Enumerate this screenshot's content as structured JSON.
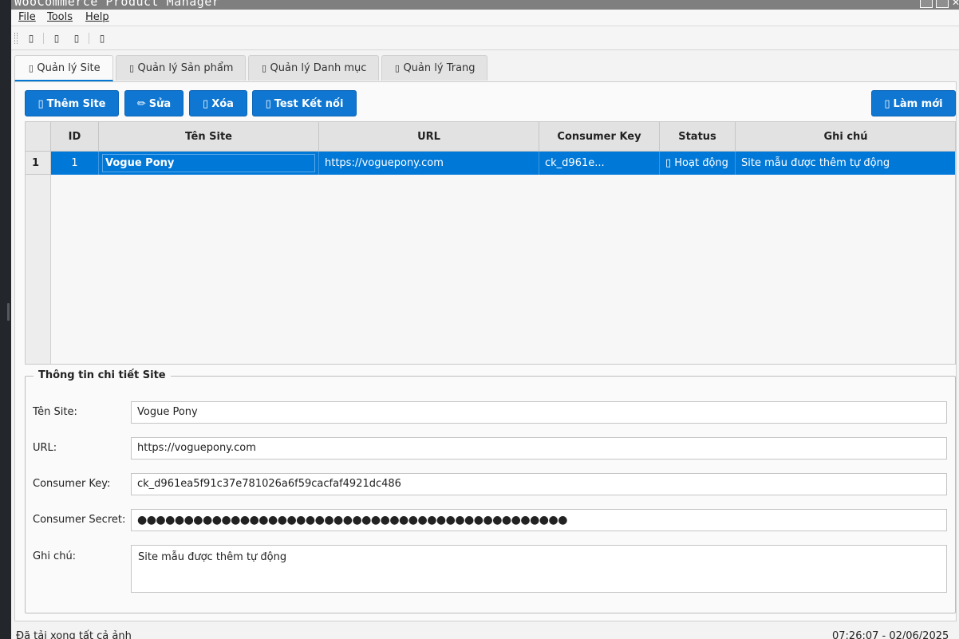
{
  "window": {
    "title": "WooCommerce Product Manager"
  },
  "menu": {
    "file": "File",
    "tools": "Tools",
    "help": "Help"
  },
  "toolbar": {
    "icons": [
      "new-icon",
      "open-icon",
      "save-icon",
      "settings-icon"
    ],
    "glyph": "▯"
  },
  "tabs": [
    {
      "label": "Quản lý Site",
      "icon": "▯"
    },
    {
      "label": "Quản lý Sản phẩm",
      "icon": "▯"
    },
    {
      "label": "Quản lý Danh mục",
      "icon": "▯"
    },
    {
      "label": "Quản lý Trang",
      "icon": "▯"
    }
  ],
  "actions": {
    "add": {
      "icon": "▯",
      "label": "Thêm Site"
    },
    "edit": {
      "icon": "✏",
      "label": "Sửa"
    },
    "delete": {
      "icon": "▯",
      "label": "Xóa"
    },
    "test": {
      "icon": "▯",
      "label": "Test Kết nối"
    },
    "refresh": {
      "icon": "▯",
      "label": "Làm mới"
    }
  },
  "table": {
    "columns": [
      "ID",
      "Tên Site",
      "URL",
      "Consumer Key",
      "Status",
      "Ghi chú"
    ],
    "rows": [
      {
        "row_header": "1",
        "id": "1",
        "name": "Vogue Pony",
        "url": "https://voguepony.com",
        "consumer_key": "ck_d961e...",
        "status": "▯ Hoạt động",
        "note": "Site mẫu được thêm tự động"
      }
    ]
  },
  "details": {
    "legend": "Thông tin chi tiết Site",
    "name_label": "Tên Site:",
    "name_value": "Vogue Pony",
    "url_label": "URL:",
    "url_value": "https://voguepony.com",
    "key_label": "Consumer Key:",
    "key_value": "ck_d961ea5f91c37e781026a6f59cacfaf4921dc486",
    "secret_label": "Consumer Secret:",
    "secret_value": "●●●●●●●●●●●●●●●●●●●●●●●●●●●●●●●●●●●●●●●●●●●●●●",
    "note_label": "Ghi chú:",
    "note_value": "Site mẫu được thêm tự động"
  },
  "status": {
    "message": "Đã tải xong tất cả ảnh",
    "datetime": "07:26:07 - 02/06/2025"
  },
  "colors": {
    "accent": "#0078d7",
    "button": "#0f77d2",
    "panel_bg": "#fafafa",
    "window_bg": "#f3f3f3"
  }
}
